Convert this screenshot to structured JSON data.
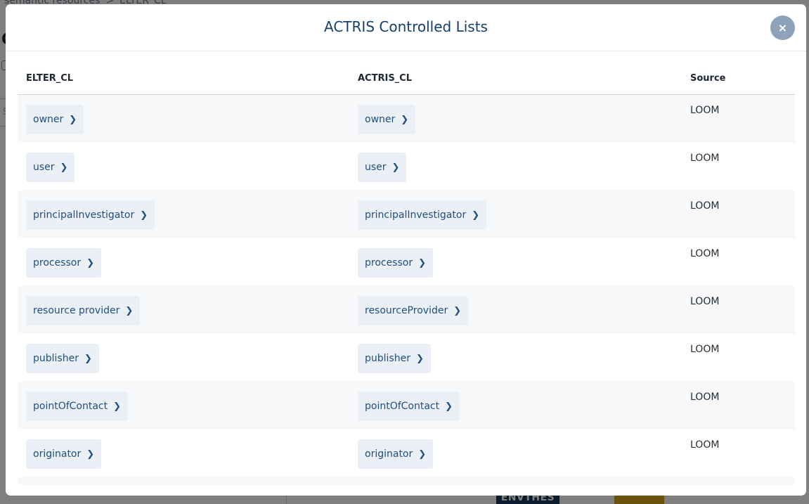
{
  "background": {
    "breadcrumb": [
      "semantic resources",
      "ELTER_CL"
    ],
    "badge": "ENVTHES"
  },
  "modal": {
    "title": "ACTRIS Controlled Lists",
    "close_label": "×"
  },
  "table": {
    "headers": [
      "ELTER_CL",
      "ACTRIS_CL",
      "Source"
    ],
    "rows": [
      {
        "elter": "owner",
        "actris": "owner",
        "source": "LOOM"
      },
      {
        "elter": "user",
        "actris": "user",
        "source": "LOOM"
      },
      {
        "elter": "principalInvestigator",
        "actris": "principalInvestigator",
        "source": "LOOM"
      },
      {
        "elter": "processor",
        "actris": "processor",
        "source": "LOOM"
      },
      {
        "elter": "resource provider",
        "actris": "resourceProvider",
        "source": "LOOM"
      },
      {
        "elter": "publisher",
        "actris": "publisher",
        "source": "LOOM"
      },
      {
        "elter": "pointOfContact",
        "actris": "pointOfContact",
        "source": "LOOM"
      },
      {
        "elter": "originator",
        "actris": "originator",
        "source": "LOOM"
      }
    ]
  },
  "icons": {
    "chip_arrow": "chevron-right-icon",
    "close": "close-icon"
  },
  "colors": {
    "title": "#16406c",
    "chip_bg": "#eaf0f6",
    "chip_text": "#1f4f7e",
    "close_bg": "#8ea3ba",
    "badge_bg": "#17385f",
    "overlay": "rgba(0,0,0,0.5)"
  }
}
